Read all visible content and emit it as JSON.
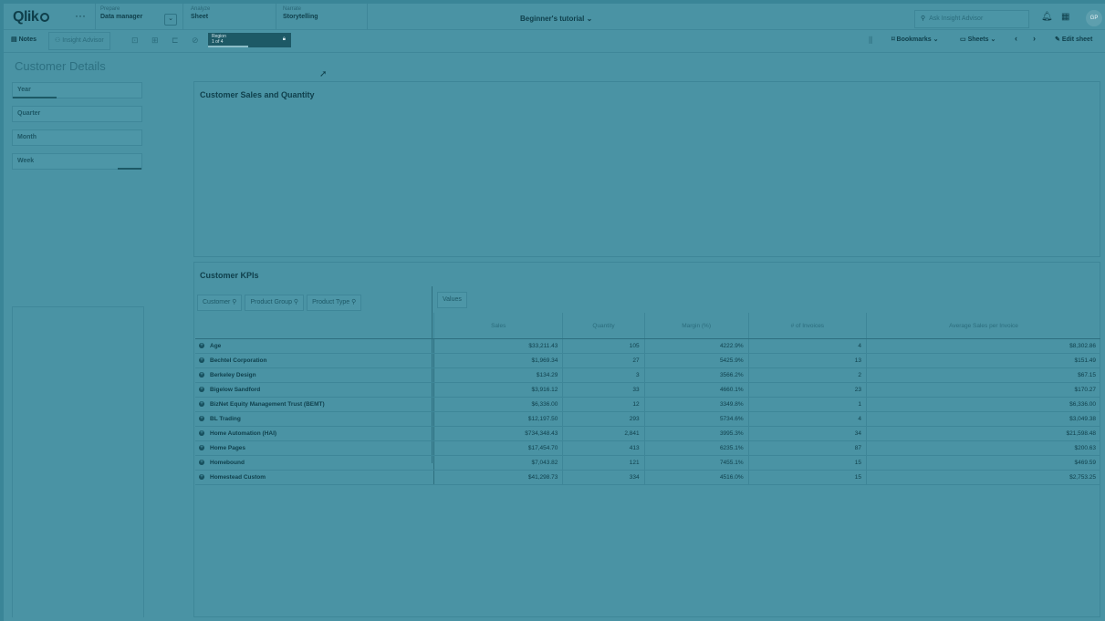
{
  "header": {
    "logo": "Qlik",
    "menu": "···",
    "nav": [
      {
        "small": "Prepare",
        "big": "Data manager"
      },
      {
        "small": "Analyze",
        "big": "Sheet"
      },
      {
        "small": "Narrate",
        "big": "Storytelling"
      }
    ],
    "dropdown": "⌄",
    "app_title": "Beginner's tutorial ⌄",
    "search_placeholder": "Ask Insight Advisor",
    "avatar": "GP"
  },
  "toolbar": {
    "notes": "Notes",
    "insight_advisor": "Insight Advisor",
    "region_label": "Region",
    "region_count": "1 of 4",
    "bookmarks": "Bookmarks ⌄",
    "sheets": "Sheets ⌄",
    "edit_sheet": "Edit sheet"
  },
  "page": {
    "title": "Customer Details"
  },
  "filters": [
    {
      "label": "Year",
      "bar": 0.33
    },
    {
      "label": "Quarter",
      "bar": 0
    },
    {
      "label": "Month",
      "bar": 0
    },
    {
      "label": "Week",
      "bar": 0.18
    }
  ],
  "chart1": {
    "title": "Customer Sales and Quantity"
  },
  "kpis": {
    "title": "Customer KPIs",
    "dims": [
      "Customer",
      "Product Group",
      "Product Type"
    ],
    "values_btn": "Values",
    "columns": [
      "Sales",
      "Quantity",
      "Margin (%)",
      "# of Invoices",
      "Average Sales per Invoice"
    ],
    "rows": [
      {
        "name": "Age",
        "v": [
          "$33,211.43",
          "105",
          "4222.9%",
          "4",
          "$8,302.86"
        ]
      },
      {
        "name": "Bechtel Corporation",
        "v": [
          "$1,969.34",
          "27",
          "5425.9%",
          "13",
          "$151.49"
        ]
      },
      {
        "name": "Berkeley Design",
        "v": [
          "$134.29",
          "3",
          "3566.2%",
          "2",
          "$67.15"
        ]
      },
      {
        "name": "Bigelow Sandford",
        "v": [
          "$3,916.12",
          "33",
          "4660.1%",
          "23",
          "$170.27"
        ]
      },
      {
        "name": "BizNet Equity Management Trust (BEMT)",
        "v": [
          "$6,336.00",
          "12",
          "3349.8%",
          "1",
          "$6,336.00"
        ]
      },
      {
        "name": "BL Trading",
        "v": [
          "$12,197.50",
          "293",
          "5734.6%",
          "4",
          "$3,049.38"
        ]
      },
      {
        "name": "Home Automation (HAI)",
        "v": [
          "$734,348.43",
          "2,841",
          "3995.3%",
          "34",
          "$21,598.48"
        ]
      },
      {
        "name": "Home Pages",
        "v": [
          "$17,454.70",
          "413",
          "6235.1%",
          "87",
          "$200.63"
        ]
      },
      {
        "name": "Homebound",
        "v": [
          "$7,043.82",
          "121",
          "7455.1%",
          "15",
          "$469.59"
        ]
      },
      {
        "name": "Homestead Custom",
        "v": [
          "$41,298.73",
          "334",
          "4516.0%",
          "15",
          "$2,753.25"
        ]
      }
    ]
  }
}
